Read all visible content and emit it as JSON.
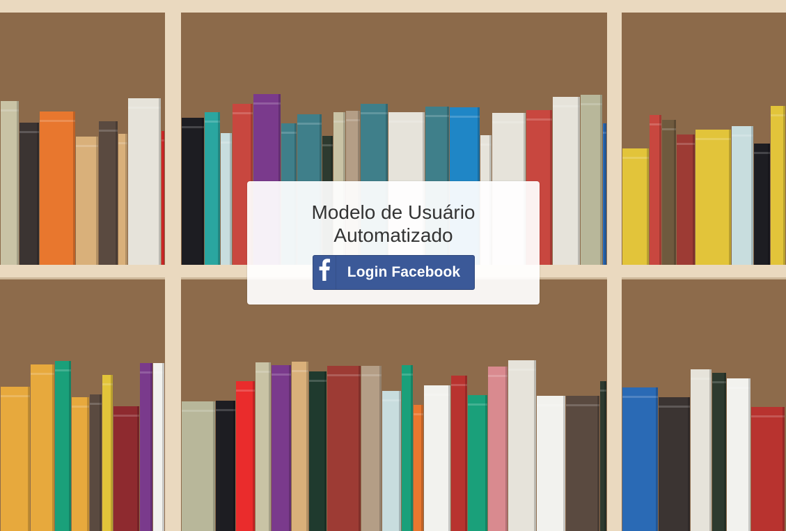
{
  "card": {
    "title_line1": "Modelo de Usuário",
    "title_line2": "Automatizado"
  },
  "login_button": {
    "label": "Login Facebook",
    "icon": "facebook-icon",
    "color": "#3b5998"
  },
  "background": {
    "subject": "bookshelf",
    "shelf_color": "#e9d8bd",
    "backing_color": "#8c6a4a"
  }
}
